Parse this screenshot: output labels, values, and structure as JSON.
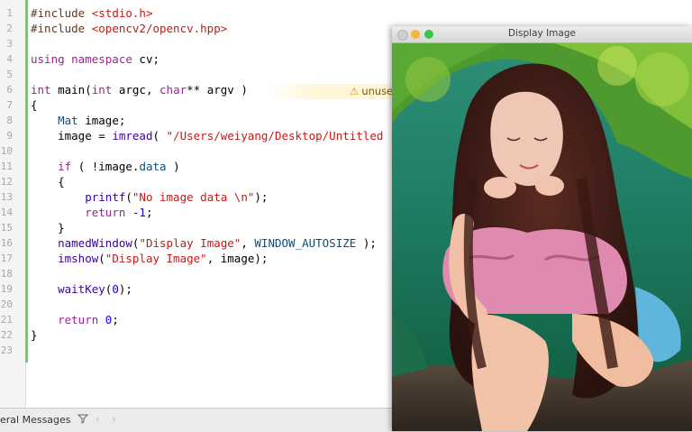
{
  "editor": {
    "line_numbers": [
      "1",
      "2",
      "3",
      "4",
      "5",
      "6",
      "7",
      "8",
      "9",
      "10",
      "11",
      "12",
      "13",
      "14",
      "15",
      "16",
      "17",
      "18",
      "19",
      "20",
      "21",
      "22",
      "23"
    ],
    "tokens": {
      "l1_kw": "#include",
      "l1_hdr": "<stdio.h>",
      "l2_kw": "#include",
      "l2_hdr": "<opencv2/opencv.hpp>",
      "l4_using": "using namespace",
      "l4_ns": "cv;",
      "l6_int": "int",
      "l6_main": "main(",
      "l6_int2": "int",
      "l6_argc": "argc,",
      "l6_char": "char",
      "l6_rest": "** argv )",
      "l7": "{",
      "l8_type": "Mat",
      "l8_rest": "image;",
      "l9_pre": "image =",
      "l9_fn": "imread",
      "l9_paren": "(",
      "l9_str": "\"/Users/weiyang/Desktop/Untitled",
      "l11_if": "if",
      "l11_open": "( !image.",
      "l11_data": "data",
      "l11_close": ")",
      "l12": "{",
      "l13_fn": "printf",
      "l13_open": "(",
      "l13_str": "\"No image data \\n\"",
      "l13_close": ");",
      "l14_ret": "return",
      "l14_num": "-1",
      "l14_semi": ";",
      "l15": "}",
      "l16_fn": "namedWindow",
      "l16_open": "(",
      "l16_str": "\"Display Image\"",
      "l16_comma": ",",
      "l16_mac": "WINDOW_AUTOSIZE",
      "l16_close": ");",
      "l17_fn": "imshow",
      "l17_open": "(",
      "l17_str": "\"Display Image\"",
      "l17_rest": ", image);",
      "l19_fn": "waitKey",
      "l19_open": "(",
      "l19_num": "0",
      "l19_close": ");",
      "l21_ret": "return",
      "l21_num": "0",
      "l21_semi": ";",
      "l22": "}"
    },
    "warning": "unuse",
    "warning_icon": "warning-triangle-icon"
  },
  "bottombar": {
    "label": "eral Messages",
    "icon": "filter-icon",
    "prev": "‹",
    "next": "›"
  },
  "image_window": {
    "title": "Display Image"
  },
  "colors": {
    "keyword": "#9b2393",
    "type": "#0b4f79",
    "function": "#3900a0",
    "string": "#c41a16",
    "number": "#1c00cf",
    "preprocessor": "#643820",
    "change_bar": "#7fc37f"
  }
}
